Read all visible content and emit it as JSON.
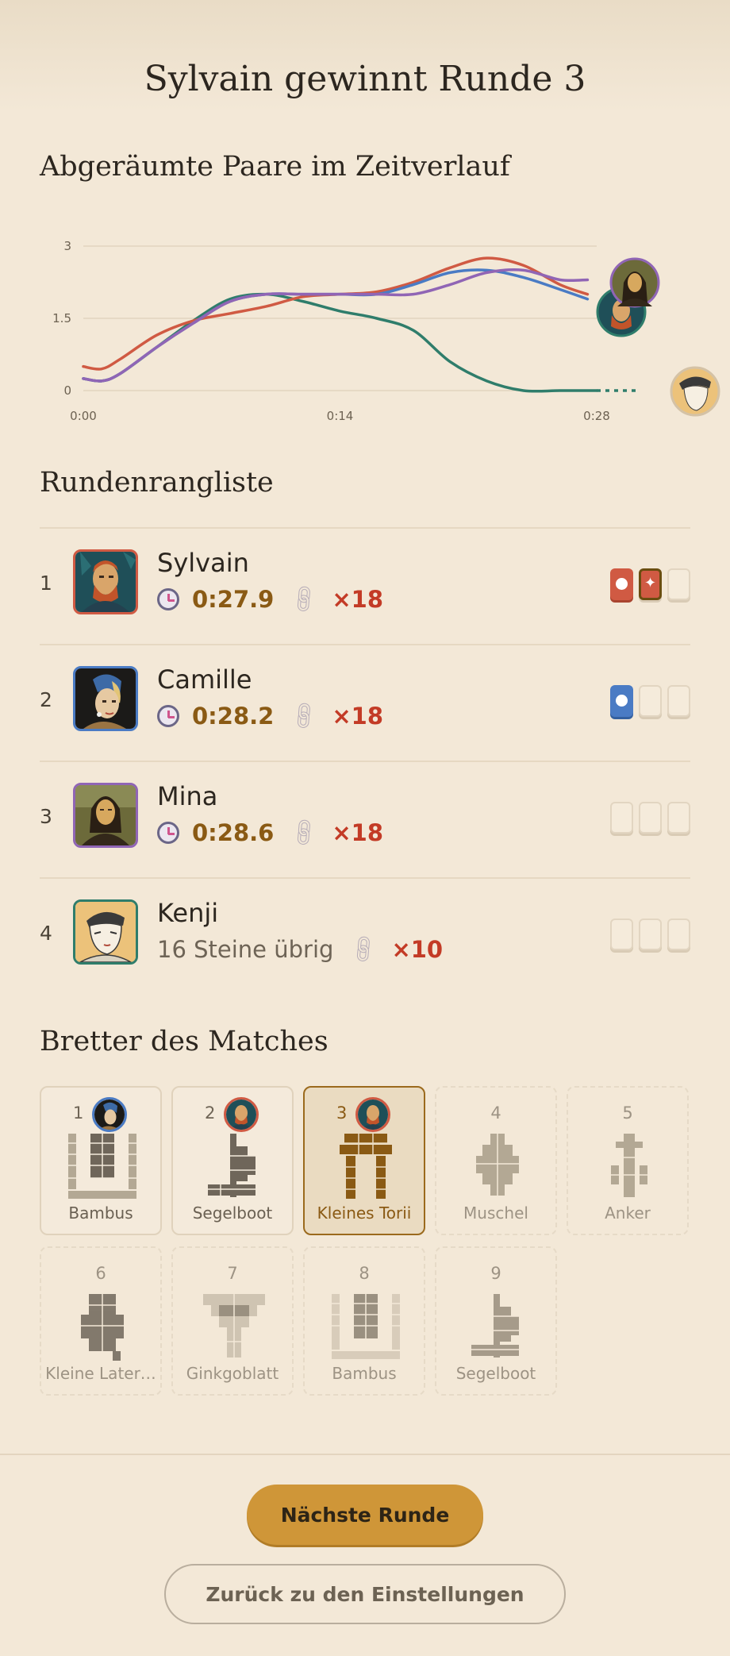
{
  "title": "Sylvain gewinnt Runde 3",
  "chart_section": {
    "heading": "Abgeräumte Paare im Zeitverlauf"
  },
  "chart_data": {
    "type": "line",
    "title": "",
    "xlabel": "",
    "ylabel": "",
    "x_ticks": [
      "0:00",
      "0:14",
      "0:28"
    ],
    "y_ticks": [
      "0",
      "1.5",
      "3"
    ],
    "xlim": [
      0,
      28
    ],
    "ylim": [
      0,
      3
    ],
    "grid": true,
    "series": [
      {
        "player": "Sylvain",
        "color": "#d05a43",
        "x": [
          0,
          1,
          2,
          4,
          6,
          8,
          10,
          12,
          14,
          16,
          18,
          20,
          22,
          24,
          26,
          27.5
        ],
        "y": [
          0.5,
          0.45,
          0.65,
          1.15,
          1.45,
          1.6,
          1.75,
          1.95,
          2.0,
          2.05,
          2.25,
          2.55,
          2.75,
          2.6,
          2.2,
          2.0
        ]
      },
      {
        "player": "Camille",
        "color": "#4a7bc4",
        "x": [
          0,
          1,
          2,
          4,
          6,
          8,
          10,
          12,
          14,
          16,
          18,
          20,
          22,
          24,
          26,
          27.5
        ],
        "y": [
          0.25,
          0.2,
          0.35,
          0.9,
          1.4,
          1.85,
          2.0,
          2.0,
          2.0,
          2.0,
          2.2,
          2.45,
          2.5,
          2.35,
          2.1,
          1.9
        ]
      },
      {
        "player": "Mina",
        "color": "#9065b5",
        "x": [
          0,
          1,
          2,
          4,
          6,
          8,
          10,
          12,
          14,
          16,
          18,
          20,
          22,
          24,
          26,
          27.5
        ],
        "y": [
          0.25,
          0.2,
          0.35,
          0.9,
          1.4,
          1.85,
          2.0,
          2.0,
          2.0,
          2.0,
          2.0,
          2.2,
          2.45,
          2.5,
          2.3,
          2.3
        ]
      },
      {
        "player": "Kenji",
        "color": "#2f7d6b",
        "x": [
          0,
          1,
          2,
          4,
          6,
          8,
          10,
          12,
          14,
          16,
          18,
          20,
          22,
          24,
          26,
          28
        ],
        "y": [
          0.25,
          0.2,
          0.35,
          0.9,
          1.45,
          1.9,
          2.0,
          1.85,
          1.65,
          1.5,
          1.25,
          0.6,
          0.2,
          0.0,
          0.0,
          0.0
        ]
      }
    ]
  },
  "ranking": {
    "heading": "Rundenrangliste",
    "rows": [
      {
        "rank": "1",
        "name": "Sylvain",
        "portrait": "van-gogh-portrait",
        "color": "#d05a43",
        "time": "0:27.9",
        "combo": "×18",
        "remaining": "",
        "wins": [
          "filled",
          "star",
          "empty"
        ]
      },
      {
        "rank": "2",
        "name": "Camille",
        "portrait": "pearl-earring-portrait",
        "color": "#4a7bc4",
        "time": "0:28.2",
        "combo": "×18",
        "remaining": "",
        "wins": [
          "filled",
          "empty",
          "empty"
        ]
      },
      {
        "rank": "3",
        "name": "Mina",
        "portrait": "mona-lisa-portrait",
        "color": "#9065b5",
        "time": "0:28.6",
        "combo": "×18",
        "remaining": "",
        "wins": [
          "empty",
          "empty",
          "empty"
        ]
      },
      {
        "rank": "4",
        "name": "Kenji",
        "portrait": "ukiyo-e-portrait",
        "color": "#2f7d6b",
        "time": "",
        "combo": "×10",
        "remaining": "16 Steine übrig",
        "wins": [
          "empty",
          "empty",
          "empty"
        ]
      }
    ]
  },
  "boards": {
    "heading": "Bretter des Matches",
    "items": [
      {
        "number": "1",
        "name": "Bambus",
        "state": "done",
        "winner": "pearl-earring-portrait",
        "winner_color": "#4a7bc4"
      },
      {
        "number": "2",
        "name": "Segelboot",
        "state": "done",
        "winner": "van-gogh-portrait",
        "winner_color": "#d05a43"
      },
      {
        "number": "3",
        "name": "Kleines Torii",
        "state": "current",
        "winner": "van-gogh-portrait",
        "winner_color": "#d05a43"
      },
      {
        "number": "4",
        "name": "Muschel",
        "state": "locked"
      },
      {
        "number": "5",
        "name": "Anker",
        "state": "locked"
      },
      {
        "number": "6",
        "name": "Kleine Later…",
        "state": "locked"
      },
      {
        "number": "7",
        "name": "Ginkgoblatt",
        "state": "locked"
      },
      {
        "number": "8",
        "name": "Bambus",
        "state": "locked"
      },
      {
        "number": "9",
        "name": "Segelboot",
        "state": "locked"
      }
    ]
  },
  "actions": {
    "next_round": "Nächste Runde",
    "back_to_settings": "Zurück zu den Einstellungen"
  }
}
